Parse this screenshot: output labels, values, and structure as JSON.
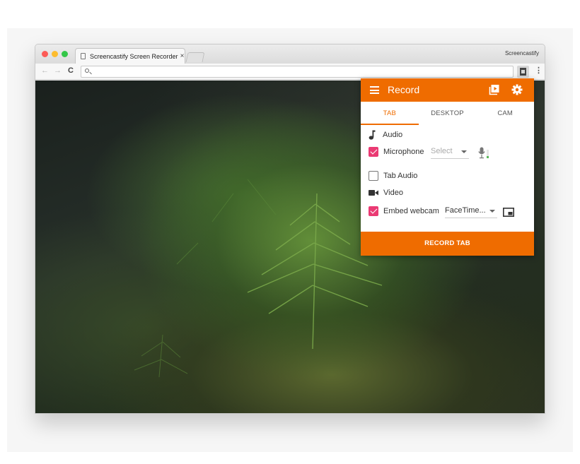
{
  "browser": {
    "tab_title": "Screencastify Screen Recorder",
    "tab_close": "×",
    "profile_name": "Screencastify",
    "back_glyph": "←",
    "forward_glyph": "→",
    "reload_glyph": "C",
    "menu_glyph": "⋮",
    "address_value": ""
  },
  "popup": {
    "title": "Record",
    "accent_color": "#ef6c00",
    "check_color": "#ea3a73",
    "tabs": [
      {
        "label": "TAB",
        "active": true
      },
      {
        "label": "DESKTOP",
        "active": false
      },
      {
        "label": "CAM",
        "active": false
      }
    ],
    "audio_heading": "Audio",
    "microphone_label": "Microphone",
    "microphone_checked": true,
    "microphone_select": "Select",
    "tab_audio_label": "Tab Audio",
    "tab_audio_checked": false,
    "video_heading": "Video",
    "webcam_label": "Embed webcam",
    "webcam_checked": true,
    "webcam_select": "FaceTime...",
    "record_button": "RECORD TAB"
  },
  "icons": [
    "traffic-lights",
    "page-icon",
    "search-icon",
    "extension-icon",
    "menu-icon",
    "library-icon",
    "gear-icon",
    "music-note-icon",
    "mic-icon",
    "camera-icon",
    "pip-icon"
  ]
}
